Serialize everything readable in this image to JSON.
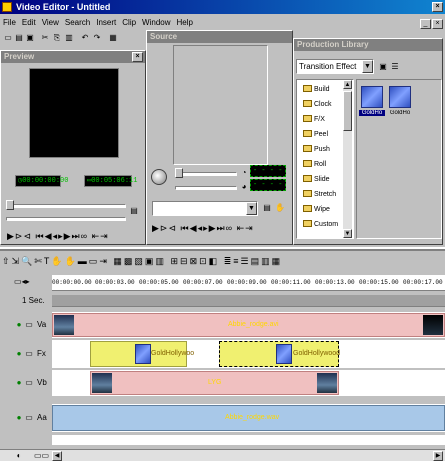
{
  "app": {
    "title": "Video Editor - Untitled",
    "menu": [
      "File",
      "Edit",
      "View",
      "Search",
      "Insert",
      "Clip",
      "Window",
      "Help"
    ]
  },
  "preview": {
    "title": "Preview",
    "timecode_current": "00:00:00:00",
    "timecode_duration": "00:05:06:11"
  },
  "source": {
    "title": "Source",
    "lcd_top": "",
    "lcd_bottom": ""
  },
  "library": {
    "title": "Production Library",
    "category": "Transition Effect",
    "items": [
      "Build",
      "Clock",
      "F/X",
      "Peel",
      "Push",
      "Roll",
      "Slide",
      "Stretch",
      "Wipe",
      "Custom"
    ],
    "thumbnails": [
      "GoldHo",
      "GoldHo"
    ]
  },
  "timeline": {
    "scale": "1 Sec.",
    "ruler": [
      "00:00:00.00",
      "00:00:03.00",
      "00:00:05.00",
      "00:00:07.00",
      "00:00:09.00",
      "00:00:11.00",
      "00:00:13.00",
      "00:00:15.00",
      "00:00:17.00"
    ],
    "tracks": [
      {
        "label": "Va",
        "clips": [
          {
            "text": "Abbie_rodge.avi"
          }
        ]
      },
      {
        "label": "Fx",
        "clips": [
          {
            "text": "GoldHollywoo"
          },
          {
            "text": "GoldHollywood"
          }
        ]
      },
      {
        "label": "Vb",
        "clips": [
          {
            "text": "LYG"
          }
        ]
      },
      {
        "label": "Aa",
        "clips": [
          {
            "text": "Abbie_rodge.wav"
          }
        ]
      }
    ]
  },
  "colors": {
    "video_clip": "#f0c0c0",
    "fx_clip": "#f0f070",
    "audio_clip": "#a8c8e8",
    "title_bar": "#000080"
  }
}
